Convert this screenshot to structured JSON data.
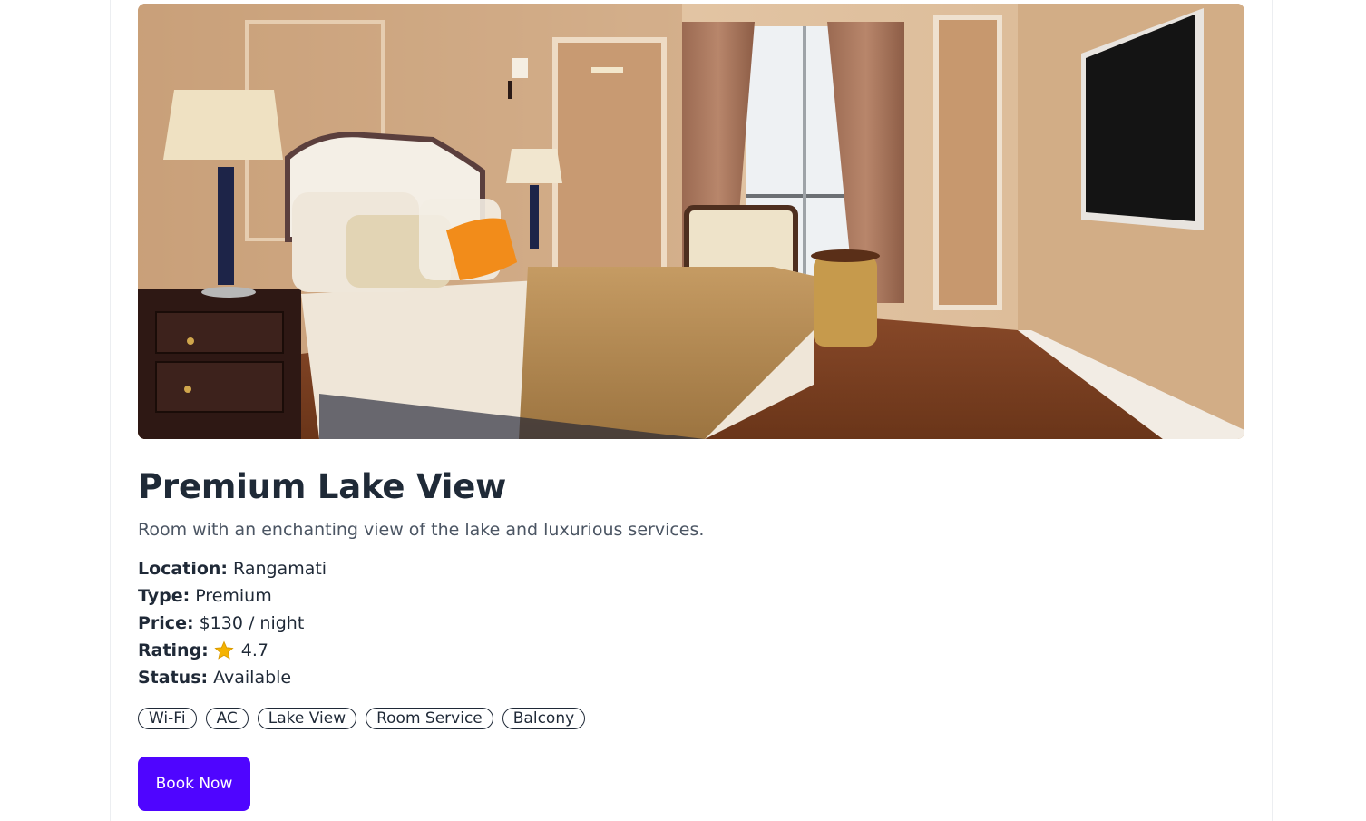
{
  "room": {
    "title": "Premium Lake View",
    "description": "Room with an enchanting view of the lake and luxurious services.",
    "details": [
      {
        "label": "Location:",
        "value": "Rangamati"
      },
      {
        "label": "Type:",
        "value": "Premium"
      },
      {
        "label": "Price:",
        "value": "$130 / night"
      },
      {
        "label": "Rating:",
        "value": "4.7",
        "icon": "star-icon"
      },
      {
        "label": "Status:",
        "value": "Available"
      }
    ],
    "amenities": [
      "Wi-Fi",
      "AC",
      "Lake View",
      "Room Service",
      "Balcony"
    ],
    "book_label": "Book Now"
  },
  "colors": {
    "accent": "#4f05ff",
    "star": "#f5b301",
    "text": "#1f2937",
    "muted": "#4b5563"
  }
}
